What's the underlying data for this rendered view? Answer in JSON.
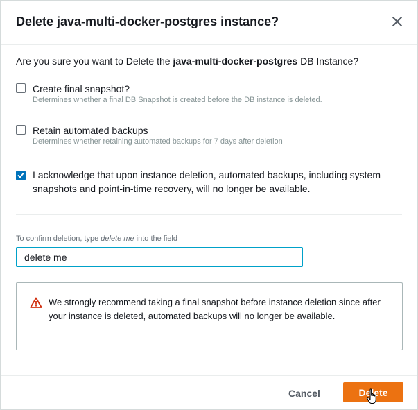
{
  "dialog": {
    "title": "Delete java-multi-docker-postgres instance?",
    "question_prefix": "Are you sure you want to Delete the ",
    "question_instance": "java-multi-docker-postgres",
    "question_suffix": " DB Instance?"
  },
  "options": {
    "final_snapshot": {
      "label": "Create final snapshot?",
      "description": "Determines whether a final DB Snapshot is created before the DB instance is deleted.",
      "checked": false
    },
    "retain_backups": {
      "label": "Retain automated backups",
      "description": "Determines whether retaining automated backups for 7 days after deletion",
      "checked": false
    },
    "acknowledge": {
      "label": "I acknowledge that upon instance deletion, automated backups, including system snapshots and point-in-time recovery, will no longer be available.",
      "checked": true
    }
  },
  "confirm": {
    "label_prefix": "To confirm deletion, type ",
    "label_emphasis": "delete me",
    "label_suffix": " into the field",
    "value": "delete me"
  },
  "warning": {
    "text": "We strongly recommend taking a final snapshot before instance deletion since after your instance is deleted, automated backups will no longer be available."
  },
  "footer": {
    "cancel_label": "Cancel",
    "delete_label": "Delete"
  },
  "colors": {
    "primary_button": "#ec7211",
    "checkbox_checked": "#0073bb",
    "input_focus": "#00a1c9",
    "warning_icon": "#d13212"
  }
}
